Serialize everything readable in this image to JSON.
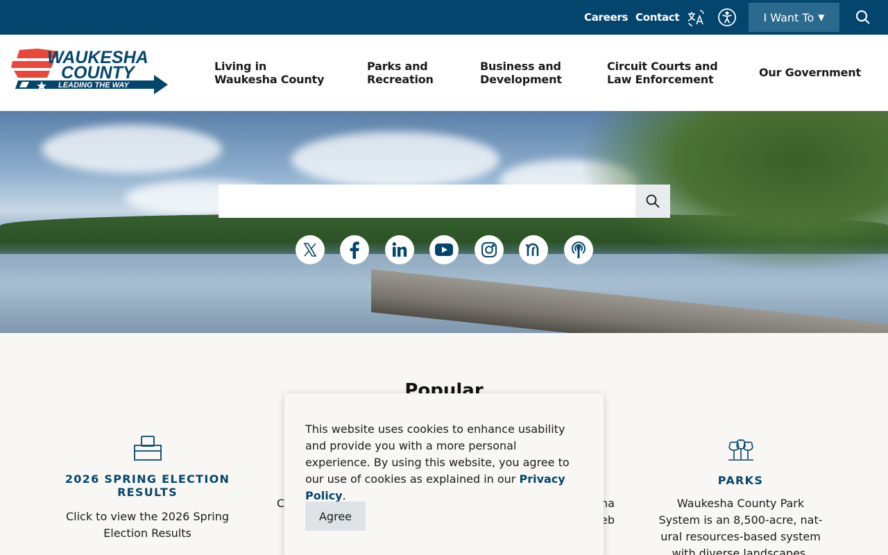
{
  "topbar": {
    "careers": "Careers",
    "contact": "Contact",
    "translate_icon": "translate-icon",
    "accessibility_icon": "accessibility-icon",
    "i_want_to": "I Want To",
    "search_icon": "search-icon"
  },
  "logo": {
    "line1": "WAUKESHA",
    "line2": "COUNTY",
    "tagline": "LEADING THE WAY"
  },
  "nav": [
    {
      "l1": "Living in",
      "l2": "Waukesha County"
    },
    {
      "l1": "Parks and",
      "l2": "Recreation"
    },
    {
      "l1": "Business and",
      "l2": "Development"
    },
    {
      "l1": "Circuit Courts and",
      "l2": "Law Enforcement"
    },
    {
      "l1": "Our Government",
      "l2": ""
    }
  ],
  "hero": {
    "search_placeholder": ""
  },
  "social": [
    "x-icon",
    "facebook-icon",
    "linkedin-icon",
    "youtube-icon",
    "instagram-icon",
    "nextdoor-icon",
    "podcast-icon"
  ],
  "popular": {
    "title": "Popular",
    "cards": [
      {
        "title_l1": "2026 SPRING ELECTION",
        "title_l2": "RESULTS",
        "desc_l1": "Click to view the 2026 Spring",
        "desc_l2": "Election Results"
      },
      {
        "title": "PARKS",
        "desc": [
          "Waukesha County Park",
          "System is an 8,500-acre, nat-",
          "ural resources-based system",
          "with diverse landscapes,"
        ]
      }
    ],
    "partial_left": "C",
    "partial_right_l1": "na",
    "partial_right_l2": "eb"
  },
  "cookie": {
    "msg_before": "This website uses cookies to enhance usability and provide you with a more personal experience. By using this website, you agree to our use of cookies as explained in our ",
    "link": "Privacy Policy",
    "msg_after": ".",
    "agree": "Agree"
  },
  "colors": {
    "brand_navy": "#03456d",
    "iwant_bg": "#2b6a8e",
    "logo_red": "#e8473b"
  }
}
